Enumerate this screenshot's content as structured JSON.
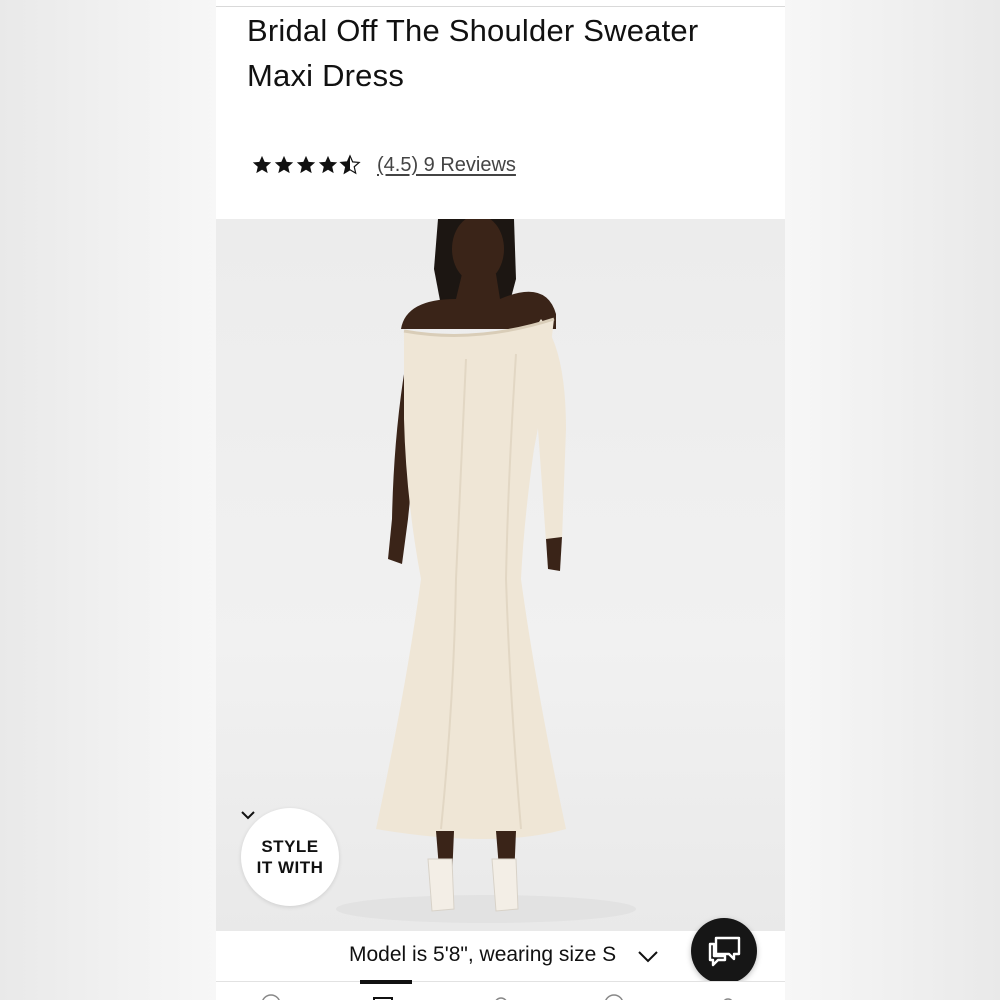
{
  "product": {
    "title": "Bridal Off The Shoulder Sweater Maxi Dress",
    "rating_value": 4.5,
    "rating_text": "(4.5) 9 Reviews"
  },
  "style_it_with": {
    "line1": "STYLE",
    "line2": "IT WITH",
    "icon": "chevron-down-icon"
  },
  "model_info": {
    "text": "Model is 5'8\", wearing size S",
    "icon": "chevron-down-icon"
  },
  "chat": {
    "icon": "chat-bubble-icon"
  },
  "bottom_nav": {
    "items": [
      "home-icon",
      "shop-icon",
      "search-icon",
      "wishlist-icon",
      "account-icon"
    ],
    "active_index": 1
  },
  "colors": {
    "dress": "#efe6d6",
    "chat_button": "#161616",
    "star": "#111111"
  }
}
